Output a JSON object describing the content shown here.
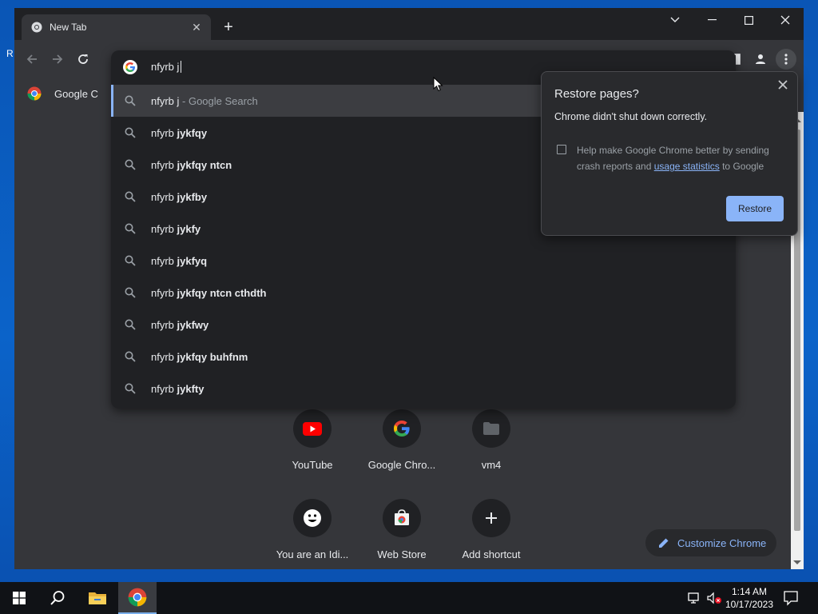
{
  "desktop": {
    "partial_text": "R"
  },
  "tab": {
    "title": "New Tab"
  },
  "omnibox": {
    "input_value": "nfyrb j",
    "top_suggestion": {
      "typed": "nfyrb j",
      "suffix": " - Google Search"
    },
    "suggestions": [
      {
        "prefix": "nfyrb ",
        "bold": "jykfqy"
      },
      {
        "prefix": "nfyrb ",
        "bold": "jykfqy ntcn"
      },
      {
        "prefix": "nfyrb ",
        "bold": "jykfby"
      },
      {
        "prefix": "nfyrb ",
        "bold": "jykfy"
      },
      {
        "prefix": "nfyrb ",
        "bold": "jykfyq"
      },
      {
        "prefix": "nfyrb ",
        "bold": "jykfqy ntcn cthdth"
      },
      {
        "prefix": "nfyrb ",
        "bold": "jykfwy"
      },
      {
        "prefix": "nfyrb ",
        "bold": "jykfqy buhfnm"
      },
      {
        "prefix": "nfyrb ",
        "bold": "jykfty"
      }
    ]
  },
  "bookmarks": {
    "item_label": "Google C"
  },
  "shortcuts": [
    {
      "label": "YouTube",
      "icon": "youtube-icon"
    },
    {
      "label": "Google Chro...",
      "icon": "google-icon"
    },
    {
      "label": "vm4",
      "icon": "folder-icon"
    },
    {
      "label": "You are an Idi...",
      "icon": "smiley-icon"
    },
    {
      "label": "Web Store",
      "icon": "web-store-icon"
    },
    {
      "label": "Add shortcut",
      "icon": "plus-icon"
    }
  ],
  "customize": {
    "label": "Customize Chrome"
  },
  "restore_popup": {
    "title": "Restore pages?",
    "message": "Chrome didn't shut down correctly.",
    "consent_before": "Help make Google Chrome better by sending crash reports and ",
    "consent_link": "usage statistics",
    "consent_after": " to Google",
    "button_label": "Restore"
  },
  "taskbar": {
    "time": "1:14 AM",
    "date": "10/17/2023"
  },
  "colors": {
    "accent": "#8ab4f8",
    "dark_bg": "#202124",
    "surface": "#35363a"
  }
}
